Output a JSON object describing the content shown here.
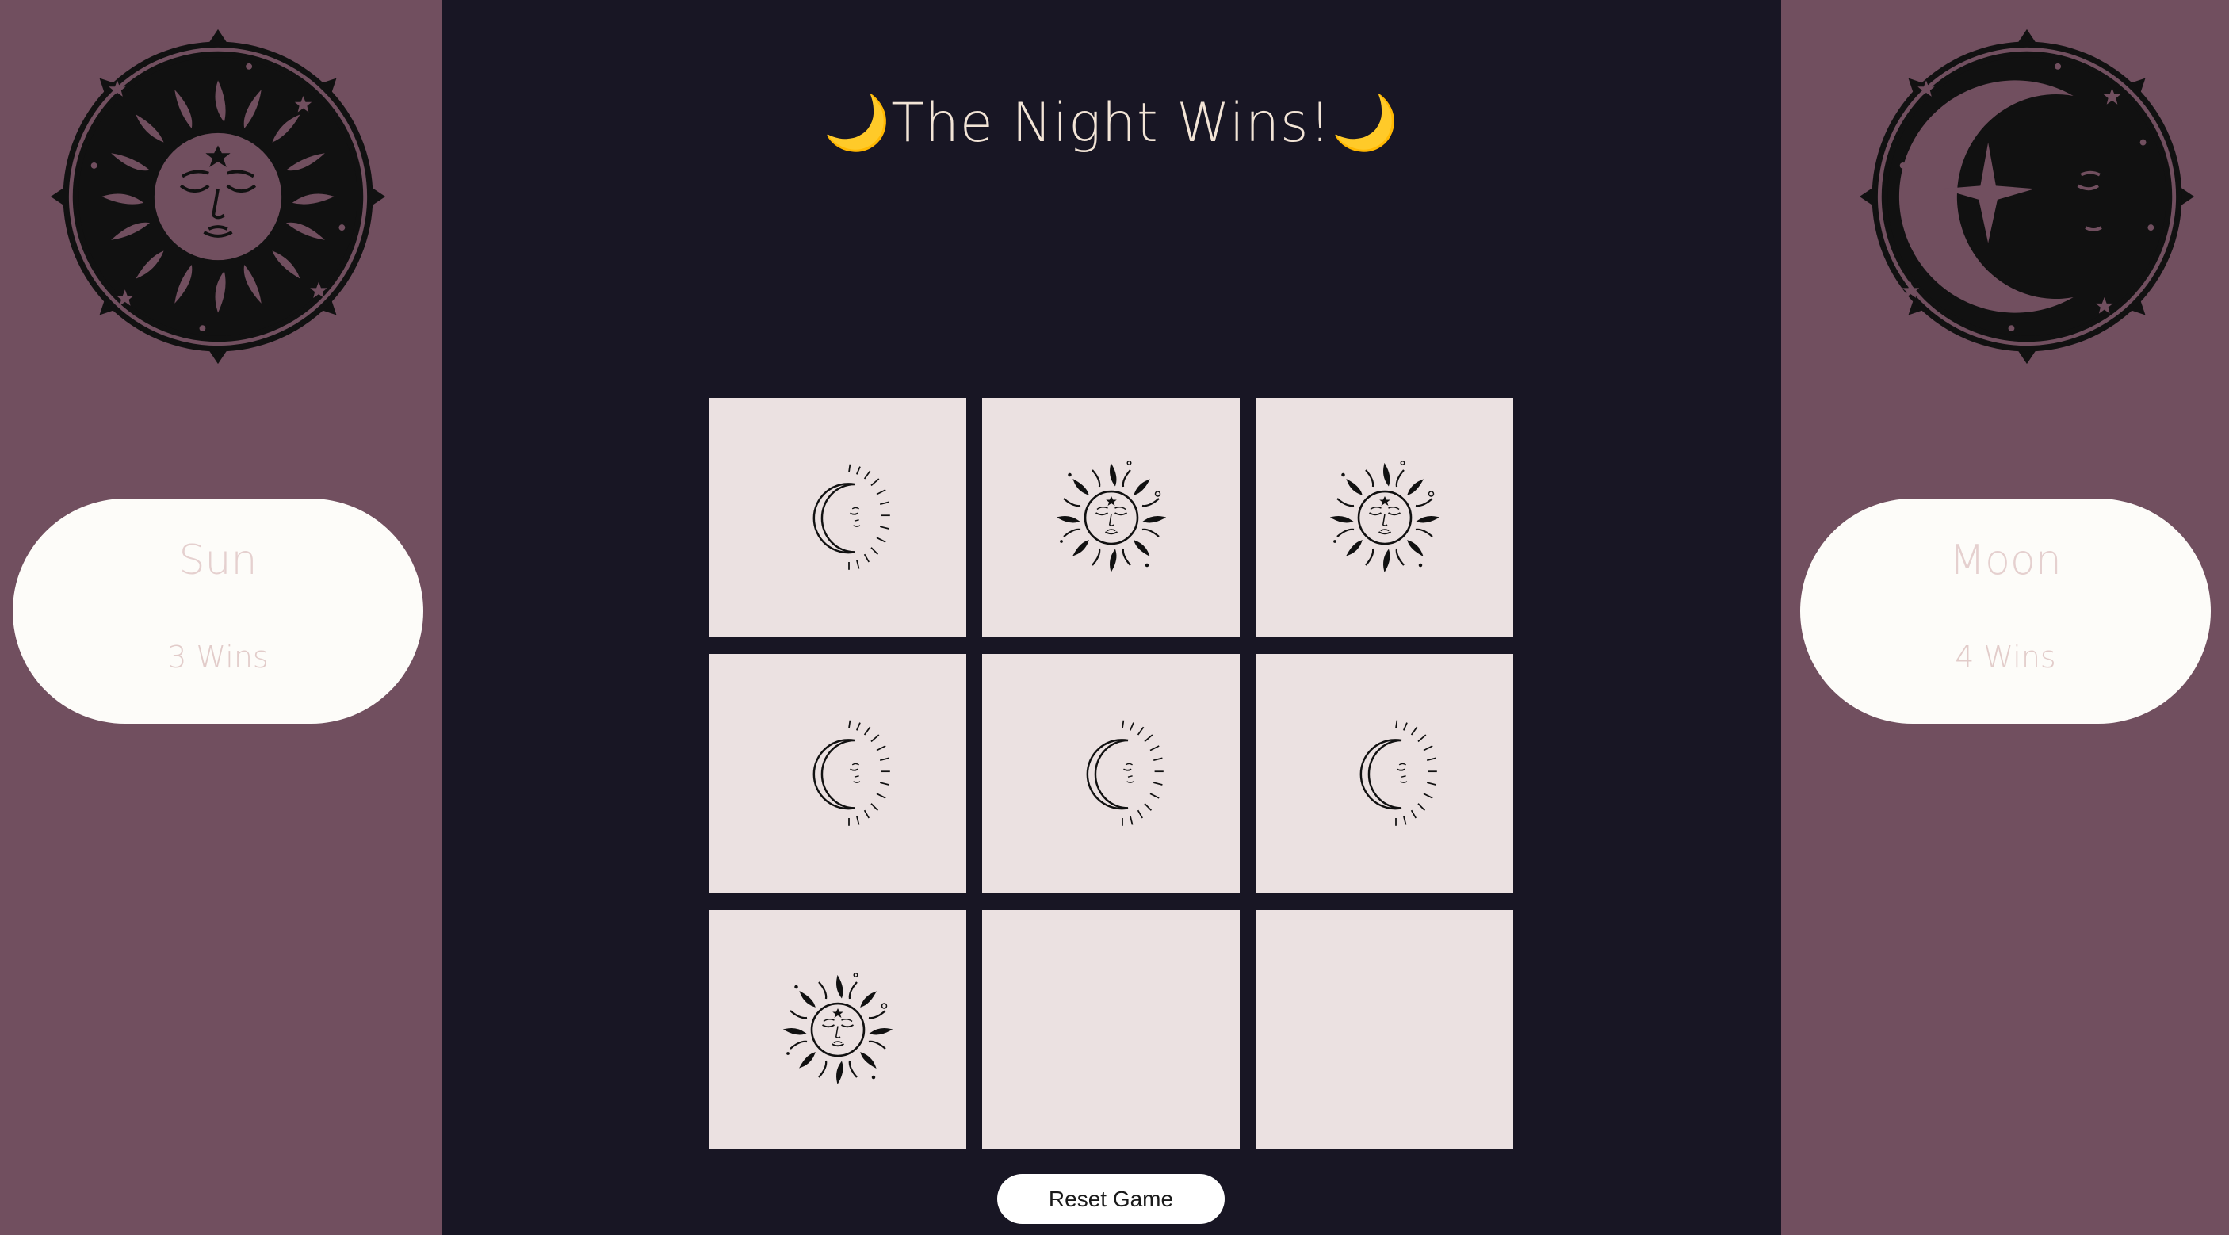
{
  "status": {
    "title": "The Night Wins!",
    "title_emoji_left": "🌙",
    "title_emoji_right": "🌙"
  },
  "players": {
    "sun": {
      "name": "Sun",
      "wins": "3 Wins",
      "emblem": "sun-face-emblem-icon"
    },
    "moon": {
      "name": "Moon",
      "wins": "4 Wins",
      "emblem": "crescent-moon-emblem-icon"
    }
  },
  "board": {
    "cells": [
      "moon",
      "sun",
      "sun",
      "moon",
      "moon",
      "moon",
      "sun",
      "",
      ""
    ]
  },
  "controls": {
    "reset_label": "Reset Game"
  },
  "colors": {
    "center_background": "#181624",
    "side_background": "#714f5f",
    "cell_background": "#ebe1e1",
    "card_background": "#fdfcf9",
    "title_text": "#f2e4d6",
    "score_text": "#e5d0cf"
  }
}
